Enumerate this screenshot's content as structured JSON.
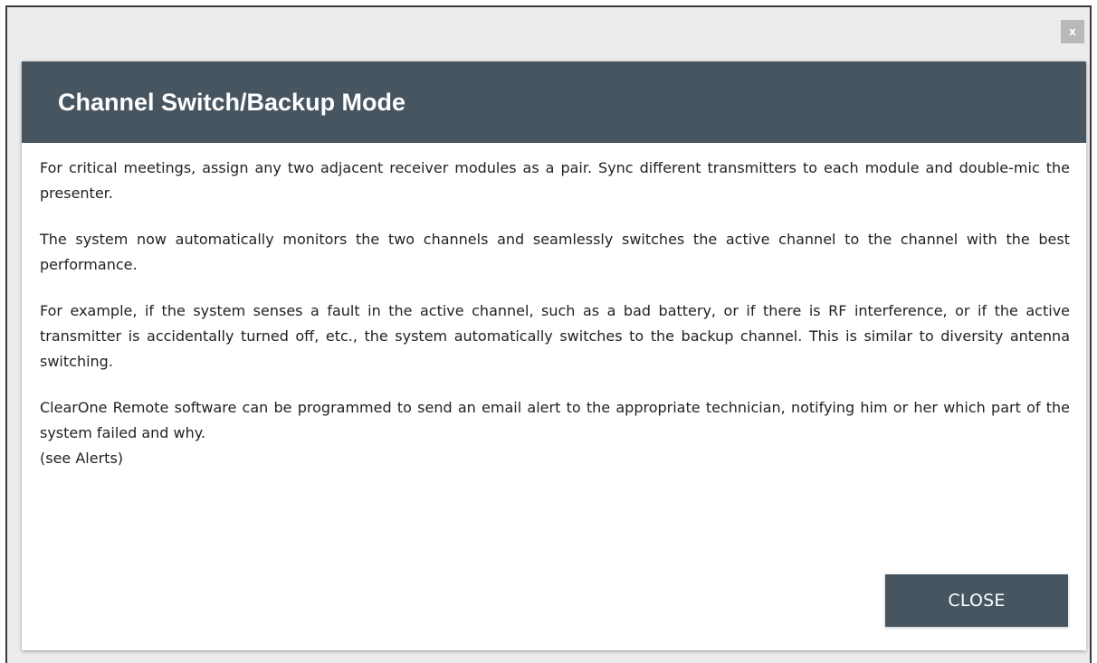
{
  "window": {
    "close_icon_glyph": "x"
  },
  "dialog": {
    "title": "Channel Switch/Backup Mode",
    "paragraphs": [
      "For critical meetings, assign any two adjacent receiver modules as a pair. Sync different transmitters to each module and double-mic the presenter.",
      "The system now automatically monitors the two channels and seamlessly switches the active channel to the channel with the best performance.",
      "For example, if the system senses a fault in the active channel, such as a bad battery, or if there is RF interference, or if the active transmitter is accidentally turned off, etc., the system automatically switches to the backup channel.  This is similar to diversity antenna switching.",
      "ClearOne Remote software can be programmed to send an email alert to the appropriate technician, notifying him or her which part of the system failed and why."
    ],
    "see_also": "(see Alerts)",
    "close_label": "CLOSE"
  },
  "colors": {
    "header_bg": "#465560",
    "button_bg": "#465560",
    "backdrop": "#ececec",
    "top_close_bg": "#b9b9b9"
  }
}
